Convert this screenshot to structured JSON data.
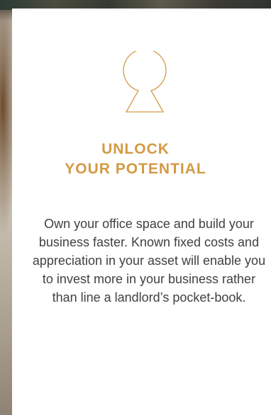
{
  "hero": {
    "icon": "keyhole-icon",
    "headline_line1": "UNLOCK",
    "headline_line2": "YOUR POTENTIAL",
    "body": "Own your office space and build your business faster. Known fixed costs and appreciation in your asset will enable you to invest more in your business rather than line a landlord’s pocket-book."
  },
  "colors": {
    "accent": "#d39a45",
    "body_text": "#414141",
    "card_background": "#ffffff"
  }
}
